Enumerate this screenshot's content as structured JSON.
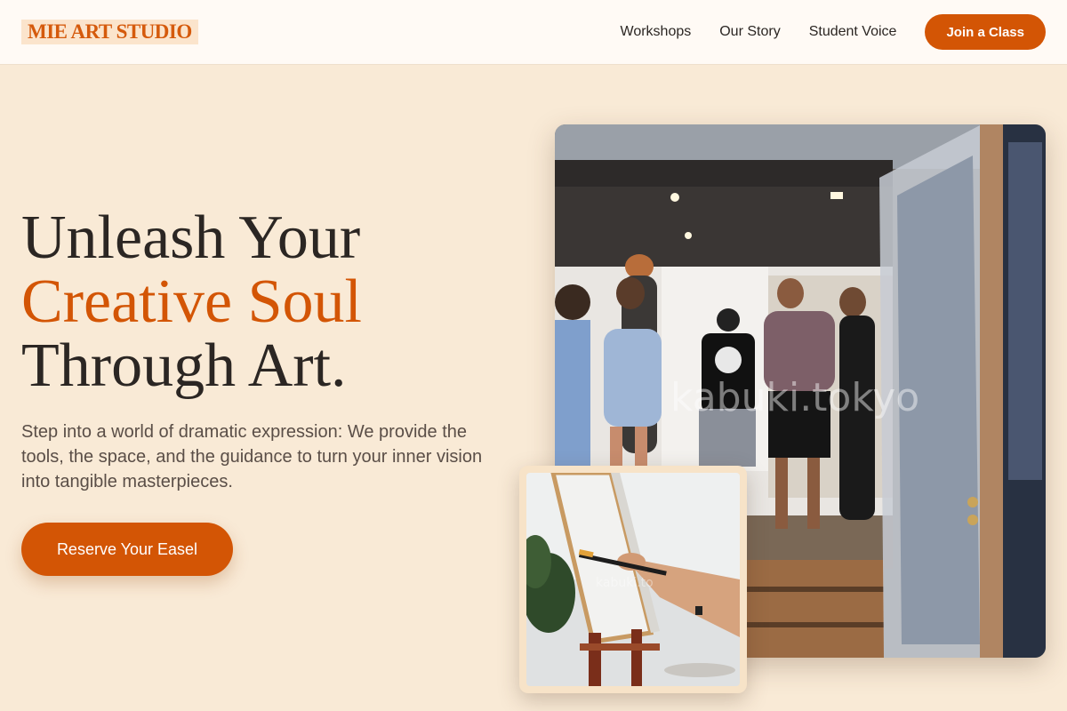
{
  "brand": {
    "logo_text": "MIE ART STUDIO"
  },
  "nav": {
    "links": [
      "Workshops",
      "Our Story",
      "Student Voice"
    ],
    "cta_label": "Join a Class"
  },
  "hero": {
    "headline_line1": "Unleash Your",
    "headline_line2": "Creative Soul",
    "headline_line3": "Through Art.",
    "subtitle": "Step into a world of dramatic expression: We provide the tools, the space, and the guidance to turn your inner vision into tangible masterpieces.",
    "cta_label": "Reserve Your Easel"
  },
  "images": {
    "main_watermark": "kabuki.tokyo",
    "small_watermark": "kabuki.to"
  },
  "colors": {
    "accent": "#d35505",
    "background": "#f9ead6",
    "header_bg": "#fffaf5",
    "text": "#2b2623"
  }
}
